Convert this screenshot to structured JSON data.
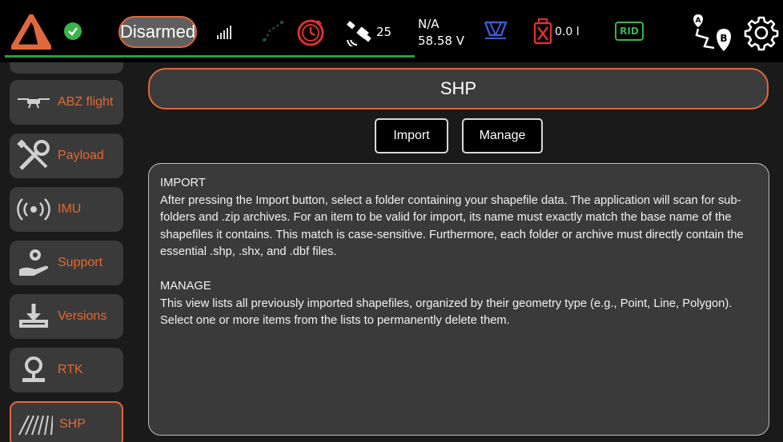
{
  "topbar": {
    "status": "Disarmed",
    "satellites": "25",
    "readout_top": "N/A",
    "voltage": "58.58 V",
    "tank": "0.0 l",
    "rid": "RID",
    "colors": {
      "accent": "#e0683e",
      "ok": "#39b54a",
      "alert": "#e0302a",
      "dim_green": "#1f5d2a",
      "blue": "#3b5bdb"
    }
  },
  "sidebar": {
    "items": [
      {
        "label": "ABZ flight",
        "icon": "drone-icon"
      },
      {
        "label": "Payload",
        "icon": "tools-icon"
      },
      {
        "label": "IMU",
        "icon": "broadcast-icon"
      },
      {
        "label": "Support",
        "icon": "support-icon"
      },
      {
        "label": "Versions",
        "icon": "download-icon"
      },
      {
        "label": "RTK",
        "icon": "location-icon"
      },
      {
        "label": "SHP",
        "icon": "field-icon"
      }
    ]
  },
  "main": {
    "title": "SHP",
    "import_label": "Import",
    "manage_label": "Manage",
    "help": {
      "import_heading": "IMPORT",
      "import_text": "After pressing the Import button, select a folder containing your shapefile data. The application will scan for sub-folders and .zip archives. For an item to be valid for import, its name must exactly match the base name of the shapefiles it contains. This match is case-sensitive. Furthermore, each folder or archive must directly contain the essential .shp, .shx, and .dbf files.",
      "manage_heading": "MANAGE",
      "manage_text": "This view lists all previously imported shapefiles, organized by their geometry type (e.g., Point, Line, Polygon). Select one or more items from the lists to permanently delete them."
    }
  }
}
